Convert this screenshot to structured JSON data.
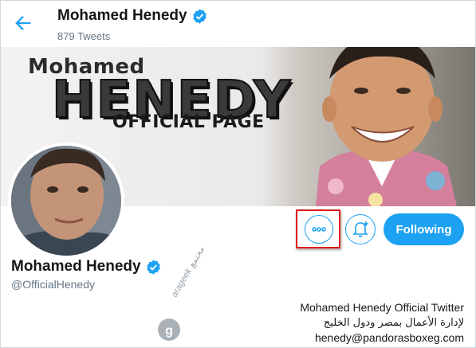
{
  "header": {
    "name": "Mohamed Henedy",
    "tweet_count": "879 Tweets"
  },
  "banner": {
    "line1": "Mohamed",
    "line2": "HENEDY",
    "line3": "OFFICIAL PAGE"
  },
  "profile": {
    "name": "Mohamed Henedy",
    "handle": "@OfficialHenedy",
    "verified": true,
    "bio": [
      "Mohamed Henedy Official Twitter",
      "لإدارة الأعمال بمصر ودول الخليج",
      "henedy@pandorasboxeg.com"
    ]
  },
  "actions": {
    "more_icon": "more-dots-icon",
    "bell_icon": "bell-plus-icon",
    "follow_label": "Following"
  },
  "watermark": {
    "text": "arageek مجتمع",
    "logo_letter": "g"
  },
  "colors": {
    "accent": "#1da1f2",
    "highlight_box": "#e0191b",
    "secondary_text": "#657786"
  }
}
